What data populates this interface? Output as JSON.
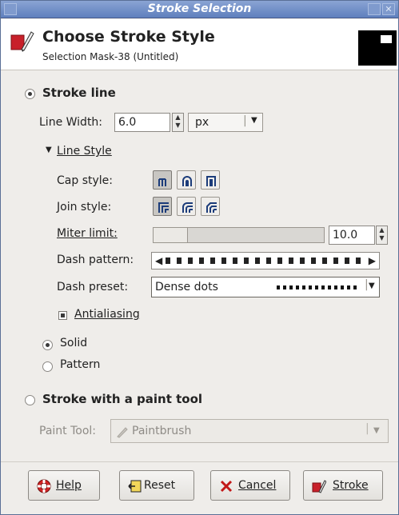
{
  "window": {
    "title": "Stroke Selection"
  },
  "header": {
    "title": "Choose Stroke Style",
    "subtitle": "Selection Mask-38 (Untitled)",
    "icon": "stroke-icon"
  },
  "stroke_line": {
    "label": "Stroke line",
    "selected": true,
    "line_width_label": "Line Width:",
    "line_width_value": "6.0",
    "unit": "px",
    "line_style_label": "Line Style",
    "line_style_expanded": true,
    "cap_style_label": "Cap style:",
    "join_style_label": "Join style:",
    "miter_limit_label": "Miter limit:",
    "miter_limit_value": "10.0",
    "miter_limit_fraction": 0.2,
    "dash_pattern_label": "Dash pattern:",
    "dash_preset_label": "Dash preset:",
    "dash_preset_value": "Dense dots",
    "antialiasing_label": "Antialiasing",
    "antialiasing_checked": true,
    "solid_label": "Solid",
    "pattern_label": "Pattern",
    "solid_selected": true
  },
  "paint_tool": {
    "label": "Stroke with a paint tool",
    "selected": false,
    "tool_label": "Paint Tool:",
    "tool_value": "Paintbrush"
  },
  "buttons": {
    "help": "Help",
    "reset": "Reset",
    "cancel": "Cancel",
    "stroke": "Stroke"
  },
  "colors": {
    "titlebar": "#6b89c4",
    "window_bg": "#efedea",
    "accent_red": "#c8202a"
  }
}
